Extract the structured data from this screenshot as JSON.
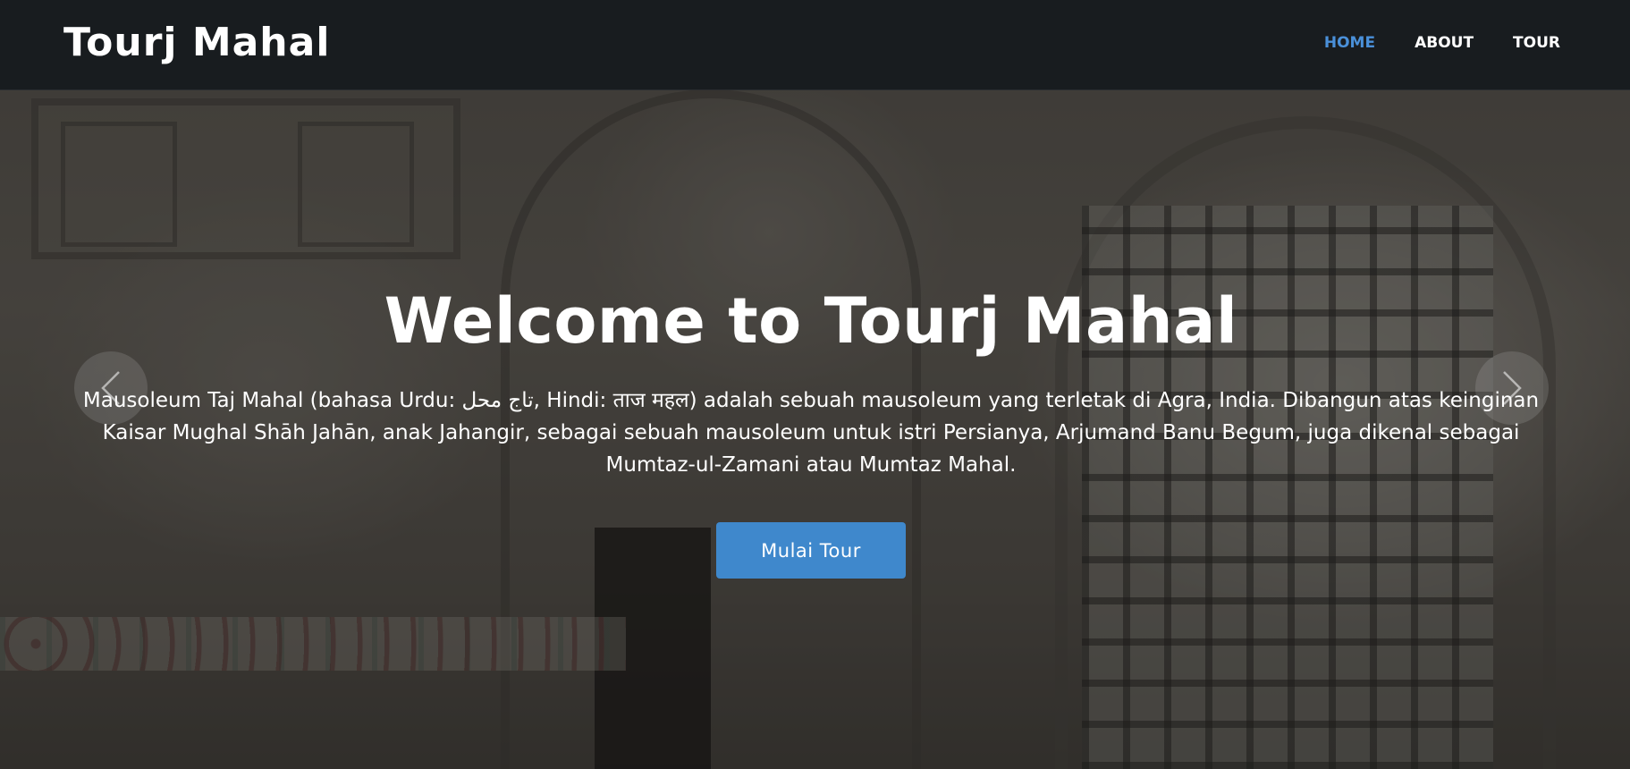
{
  "navbar": {
    "brand": "Tourj Mahal",
    "links": [
      {
        "label": "HOME",
        "active": true
      },
      {
        "label": "ABOUT",
        "active": false
      },
      {
        "label": "TOUR",
        "active": false
      }
    ],
    "active_color": "#4a90d9"
  },
  "hero": {
    "title": "Welcome to Tourj Mahal",
    "description": "Mausoleum Taj Mahal (bahasa Urdu: تاج محل, Hindi: ताज महल) adalah sebuah mausoleum yang terletak di Agra, India. Dibangun atas keinginan Kaisar Mughal Shāh Jahān, anak Jahangir, sebagai sebuah mausoleum untuk istri Persianya, Arjumand Banu Begum, juga dikenal sebagai Mumtaz-ul-Zamani atau Mumtaz Mahal.",
    "cta_label": "Mulai Tour",
    "cta_color": "#3f88cc"
  },
  "carousel": {
    "prev_icon": "chevron-left-icon",
    "next_icon": "chevron-right-icon"
  }
}
